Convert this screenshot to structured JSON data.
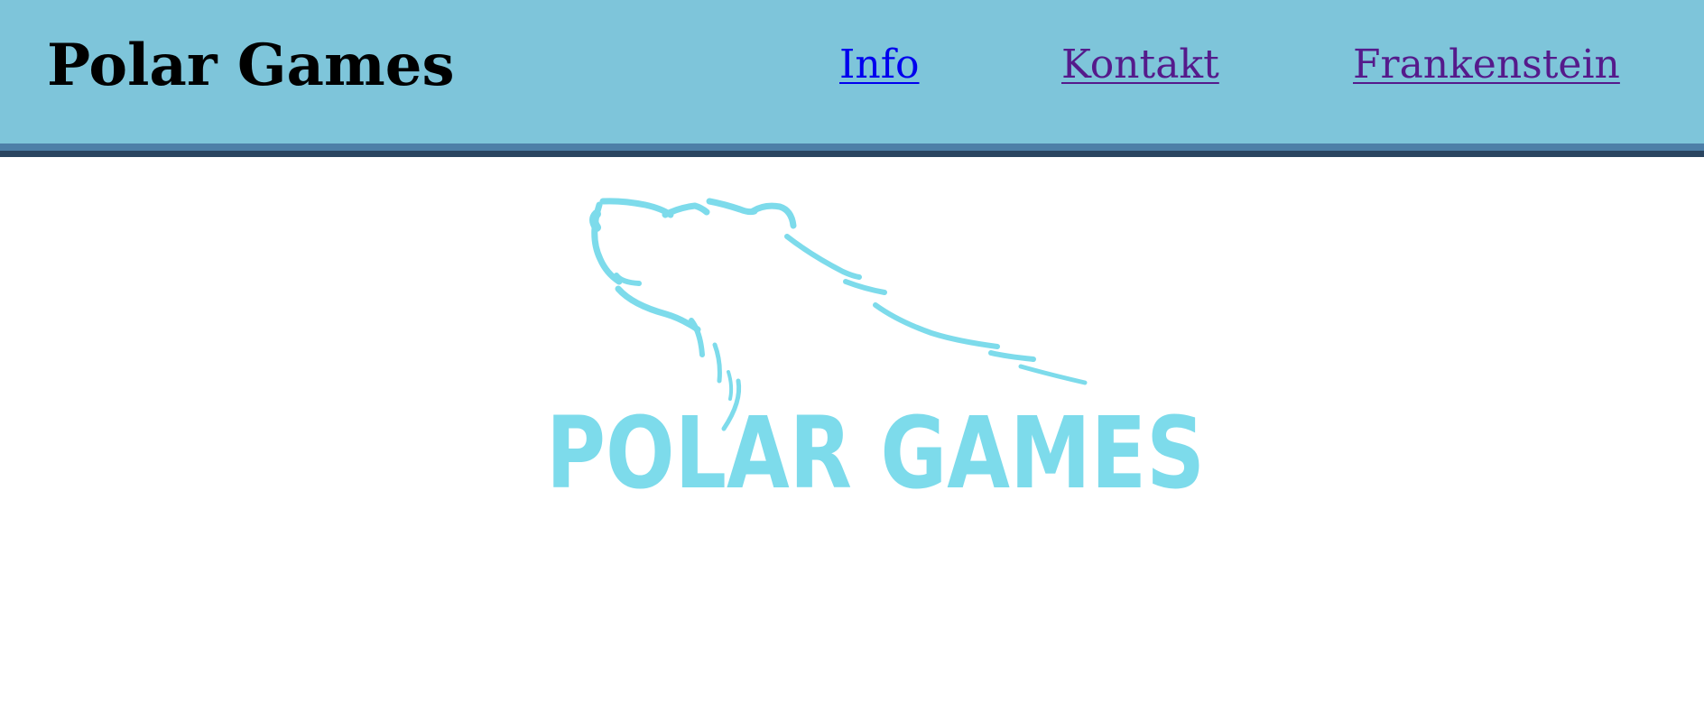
{
  "header": {
    "title": "Polar Games",
    "background_color": "#7ec5da"
  },
  "nav": {
    "items": [
      {
        "label": "Info",
        "color": "#0000ee",
        "state": "unvisited"
      },
      {
        "label": "Kontakt",
        "color": "#551a8b",
        "state": "visited"
      },
      {
        "label": "Frankenstein",
        "color": "#551a8b",
        "state": "visited"
      }
    ]
  },
  "logo": {
    "text": "POLAR GAMES",
    "icon": "polar-bear-head-icon",
    "color": "#7ddbeb"
  }
}
